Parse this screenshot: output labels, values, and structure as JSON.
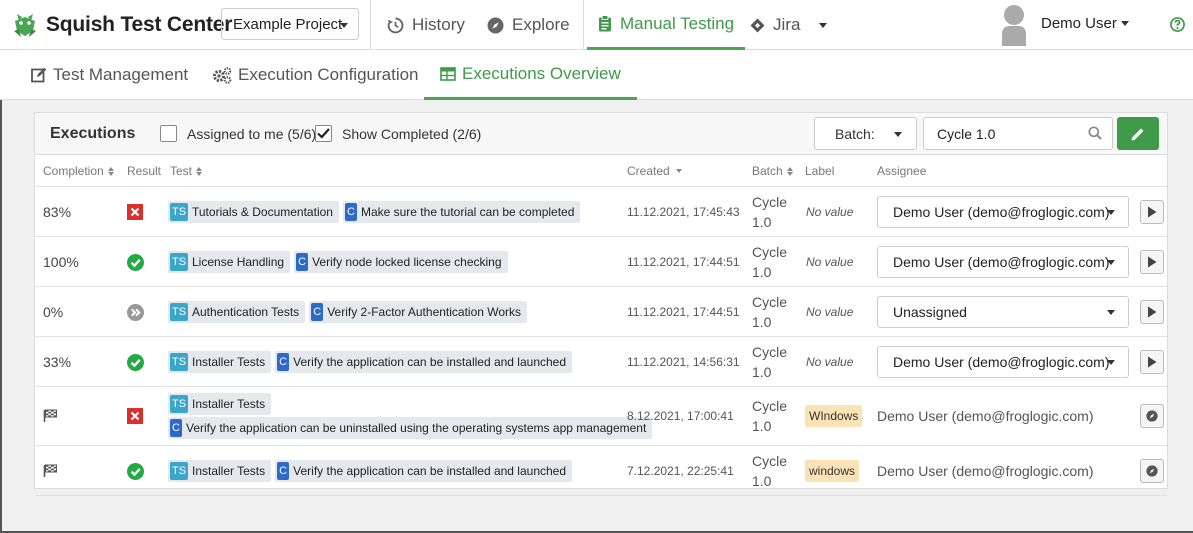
{
  "header": {
    "app_name": "Squish Test Center",
    "project": "Example Project",
    "nav": [
      {
        "label": "History",
        "icon": "history-icon"
      },
      {
        "label": "Explore",
        "icon": "compass-icon"
      },
      {
        "label": "Manual Testing",
        "icon": "clipboard-icon",
        "active": true
      },
      {
        "label": "Jira",
        "icon": "jira-icon"
      }
    ],
    "user": "Demo User"
  },
  "subtabs": [
    {
      "label": "Test Management",
      "icon": "edit-icon"
    },
    {
      "label": "Execution Configuration",
      "icon": "gears-icon"
    },
    {
      "label": "Executions Overview",
      "icon": "table-icon",
      "active": true
    }
  ],
  "executions": {
    "title": "Executions",
    "assigned_to_me": {
      "label": "Assigned to me (5/6)",
      "checked": false
    },
    "show_completed": {
      "label": "Show Completed (2/6)",
      "checked": true
    },
    "batch_filter_label": "Batch:",
    "search_value": "Cycle 1.0",
    "columns": [
      "Completion",
      "Result",
      "Test",
      "Created",
      "Batch",
      "Label",
      "Assignee"
    ],
    "rows": [
      {
        "completion": "83%",
        "result": "failed",
        "suite": "Tutorials & Documentation",
        "case": "Make sure the tutorial can be completed",
        "created": "11.12.2021, 17:45:43",
        "batch": [
          "Cycle",
          "1.0"
        ],
        "label": "No value",
        "assignee": "Demo User (demo@froglogic.com)",
        "editable": true
      },
      {
        "completion": "100%",
        "result": "passed",
        "suite": "License Handling",
        "case": "Verify node locked license checking",
        "created": "11.12.2021, 17:44:51",
        "batch": [
          "Cycle",
          "1.0"
        ],
        "label": "No value",
        "assignee": "Demo User (demo@froglogic.com)",
        "editable": true
      },
      {
        "completion": "0%",
        "result": "skipped",
        "suite": "Authentication Tests",
        "case": "Verify 2-Factor Authentication Works",
        "created": "11.12.2021, 17:44:51",
        "batch": [
          "Cycle",
          "1.0"
        ],
        "label": "No value",
        "assignee": "Unassigned",
        "editable": true
      },
      {
        "completion": "33%",
        "result": "passed",
        "suite": "Installer Tests",
        "case": "Verify the application can be installed and launched",
        "created": "11.12.2021, 14:56:31",
        "batch": [
          "Cycle",
          "1.0"
        ],
        "label": "No value",
        "assignee": "Demo User (demo@froglogic.com)",
        "editable": true
      },
      {
        "completion": "flag",
        "result": "failed",
        "suite": "Installer Tests",
        "case": "Verify the application can be uninstalled using the operating systems app management",
        "created": "8.12.2021, 17:00:41",
        "batch": [
          "Cycle",
          "1.0"
        ],
        "label": "WIndows",
        "assignee": "Demo User (demo@froglogic.com)",
        "editable": false
      },
      {
        "completion": "flag",
        "result": "passed",
        "suite": "Installer Tests",
        "case": "Verify the application can be installed and launched",
        "created": "7.12.2021, 22:25:41",
        "batch": [
          "Cycle",
          "1.0"
        ],
        "label": "windows",
        "assignee": "Demo User (demo@froglogic.com)",
        "editable": false
      }
    ]
  },
  "colors": {
    "accent": "#3f9a4a",
    "failed": "#d9302c",
    "passed": "#22aa44",
    "skipped": "#999999",
    "ts_badge": "#3aa6c9",
    "case_badge": "#2c69c9",
    "label_tag": "#fbe3b5"
  }
}
